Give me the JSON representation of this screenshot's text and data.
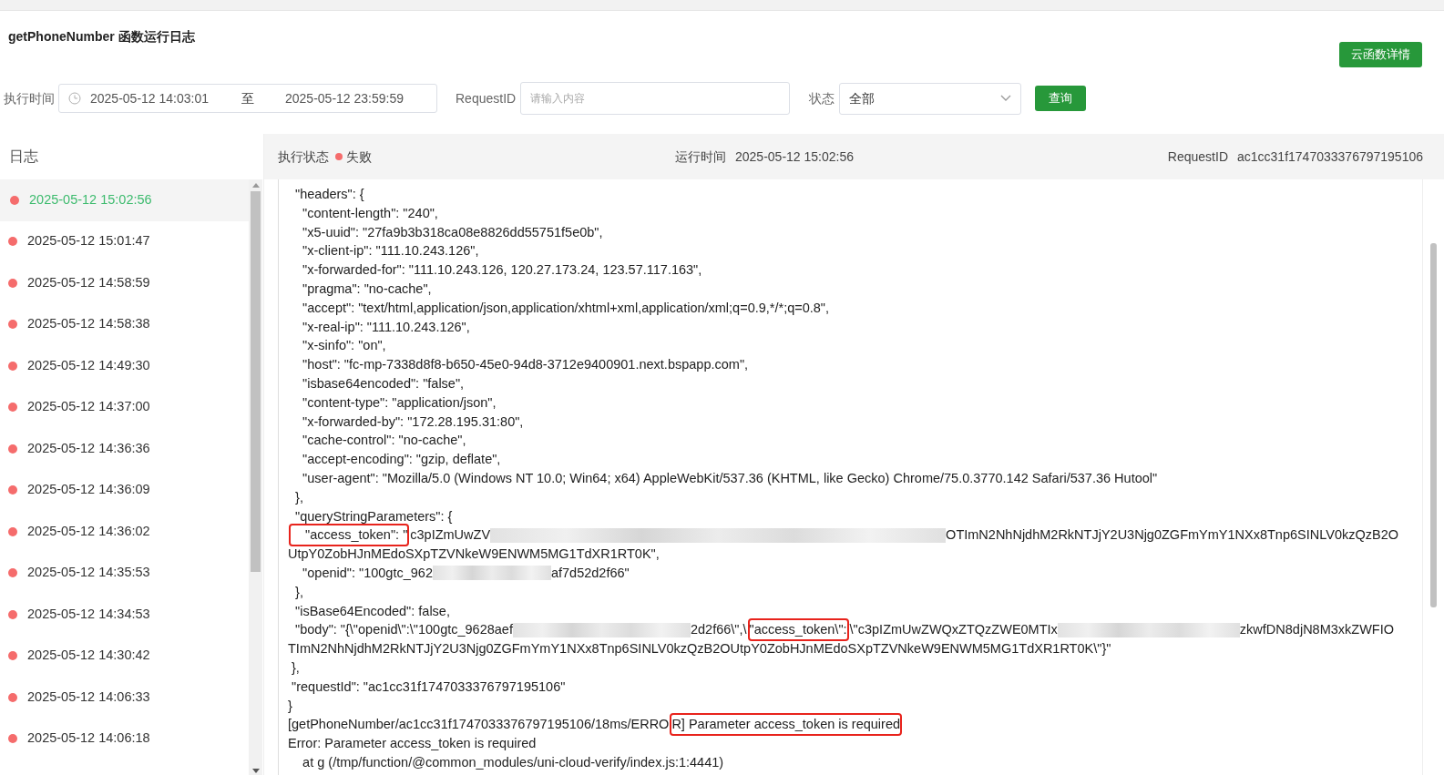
{
  "title": "getPhoneNumber 函数运行日志",
  "detail_button": "云函数详情",
  "filters": {
    "time_label": "执行时间",
    "start": "2025-05-12 14:03:01",
    "separator": "至",
    "end": "2025-05-12 23:59:59",
    "request_label": "RequestID",
    "request_placeholder": "请输入内容",
    "status_label": "状态",
    "status_value": "全部",
    "query_button": "查询"
  },
  "sidebar": {
    "title": "日志",
    "items": [
      {
        "time": "2025-05-12 15:02:56",
        "selected": true,
        "color": "#f56c6c"
      },
      {
        "time": "2025-05-12 15:01:47",
        "selected": false,
        "color": "#f56c6c"
      },
      {
        "time": "2025-05-12 14:58:59",
        "selected": false,
        "color": "#f56c6c"
      },
      {
        "time": "2025-05-12 14:58:38",
        "selected": false,
        "color": "#f56c6c"
      },
      {
        "time": "2025-05-12 14:49:30",
        "selected": false,
        "color": "#f56c6c"
      },
      {
        "time": "2025-05-12 14:37:00",
        "selected": false,
        "color": "#f56c6c"
      },
      {
        "time": "2025-05-12 14:36:36",
        "selected": false,
        "color": "#f56c6c"
      },
      {
        "time": "2025-05-12 14:36:09",
        "selected": false,
        "color": "#f56c6c"
      },
      {
        "time": "2025-05-12 14:36:02",
        "selected": false,
        "color": "#f56c6c"
      },
      {
        "time": "2025-05-12 14:35:53",
        "selected": false,
        "color": "#f56c6c"
      },
      {
        "time": "2025-05-12 14:34:53",
        "selected": false,
        "color": "#f56c6c"
      },
      {
        "time": "2025-05-12 14:30:42",
        "selected": false,
        "color": "#f56c6c"
      },
      {
        "time": "2025-05-12 14:06:33",
        "selected": false,
        "color": "#f56c6c"
      },
      {
        "time": "2025-05-12 14:06:18",
        "selected": false,
        "color": "#f56c6c"
      }
    ]
  },
  "detail_header": {
    "status_label": "执行状态",
    "status": "失败",
    "failed": true,
    "run_time_label": "运行时间",
    "run_time": "2025-05-12 15:02:56",
    "request_label": "RequestID",
    "request_id": "ac1cc31f1747033376797195106"
  },
  "log_lines": [
    [
      {
        "text": "  \"headers\": {"
      }
    ],
    [
      {
        "text": "    \"content-length\": \"240\","
      }
    ],
    [
      {
        "text": "    \"x5-uuid\": \"27fa9b3b318ca08e8826dd55751f5e0b\","
      }
    ],
    [
      {
        "text": "    \"x-client-ip\": \"111.10.243.126\","
      }
    ],
    [
      {
        "text": "    \"x-forwarded-for\": \"111.10.243.126, 120.27.173.24, 123.57.117.163\","
      }
    ],
    [
      {
        "text": "    \"pragma\": \"no-cache\","
      }
    ],
    [
      {
        "text": "    \"accept\": \"text/html,application/json,application/xhtml+xml,application/xml;q=0.9,*/*;q=0.8\","
      }
    ],
    [
      {
        "text": "    \"x-real-ip\": \"111.10.243.126\","
      }
    ],
    [
      {
        "text": "    \"x-sinfo\": \"on\","
      }
    ],
    [
      {
        "text": "    \"host\": \"fc-mp-7338d8f8-b650-45e0-94d8-3712e9400901.next.bspapp.com\","
      }
    ],
    [
      {
        "text": "    \"isbase64encoded\": \"false\","
      }
    ],
    [
      {
        "text": "    \"content-type\": \"application/json\","
      }
    ],
    [
      {
        "text": "    \"x-forwarded-by\": \"172.28.195.31:80\","
      }
    ],
    [
      {
        "text": "    \"cache-control\": \"no-cache\","
      }
    ],
    [
      {
        "text": "    \"accept-encoding\": \"gzip, deflate\","
      }
    ],
    [
      {
        "text": "    \"user-agent\": \"Mozilla/5.0 (Windows NT 10.0; Win64; x64) AppleWebKit/537.36 (KHTML, like Gecko) Chrome/75.0.3770.142 Safari/537.36 Hutool\""
      }
    ],
    [
      {
        "text": "  },"
      }
    ],
    [
      {
        "text": "  \"queryStringParameters\": {"
      }
    ],
    [
      {
        "text": "    \"access_token\": \"",
        "highlighted": true
      },
      {
        "text": "c3pIZmUwZV"
      },
      {
        "kind": "redacted-xl"
      },
      {
        "text": "OTImN2NhNjdhM2RkNTJjY2U3Njg0ZGFmYmY1NXx8Tnp6SINLV0kzQzB2O"
      }
    ],
    [
      {
        "text": "UtpY0ZobHJnMEdoSXpTZVNkeW9ENWM5MG1TdXR1RT0K\","
      }
    ],
    [
      {
        "text": "    \"openid\": \"100gtc_962"
      },
      {
        "kind": "redacted-sm"
      },
      {
        "text": "af7d52d2f66\""
      }
    ],
    [
      {
        "text": "  },"
      }
    ],
    [
      {
        "text": "  \"isBase64Encoded\": false,"
      }
    ],
    [
      {
        "text": "  \"body\": \"{\\\"openid\\\":\\\"100gtc_9628aef"
      },
      {
        "kind": "redacted-md"
      },
      {
        "text": "2d2f66\\\",\\"
      },
      {
        "text": "\"access_token\\\":",
        "highlighted": true
      },
      {
        "text": "\\\"c3pIZmUwZWQxZTQzZWE0MTIx"
      },
      {
        "kind": "redacted-lg"
      },
      {
        "text": "zkwfDN8djN8M3xkZWFIO"
      }
    ],
    [
      {
        "text": "TImN2NhNjdhM2RkNTJjY2U3Njg0ZGFmYmY1NXx8Tnp6SINLV0kzQzB2OUtpY0ZobHJnMEdoSXpTZVNkeW9ENWM5MG1TdXR1RT0K\\\"}\""
      }
    ],
    [
      {
        "text": " },"
      }
    ],
    [
      {
        "text": " \"requestId\": \"ac1cc31f1747033376797195106\""
      }
    ],
    [
      {
        "text": "}"
      }
    ],
    [
      {
        "text": "[getPhoneNumber/ac1cc31f1747033376797195106/18ms/ERRO"
      },
      {
        "text": "R] Parameter access_token is required",
        "highlighted": true
      }
    ],
    [
      {
        "text": "Error: Parameter access_token is required"
      }
    ],
    [
      {
        "text": "    at g (/tmp/function/@common_modules/uni-cloud-verify/index.js:1:4441)"
      }
    ]
  ]
}
